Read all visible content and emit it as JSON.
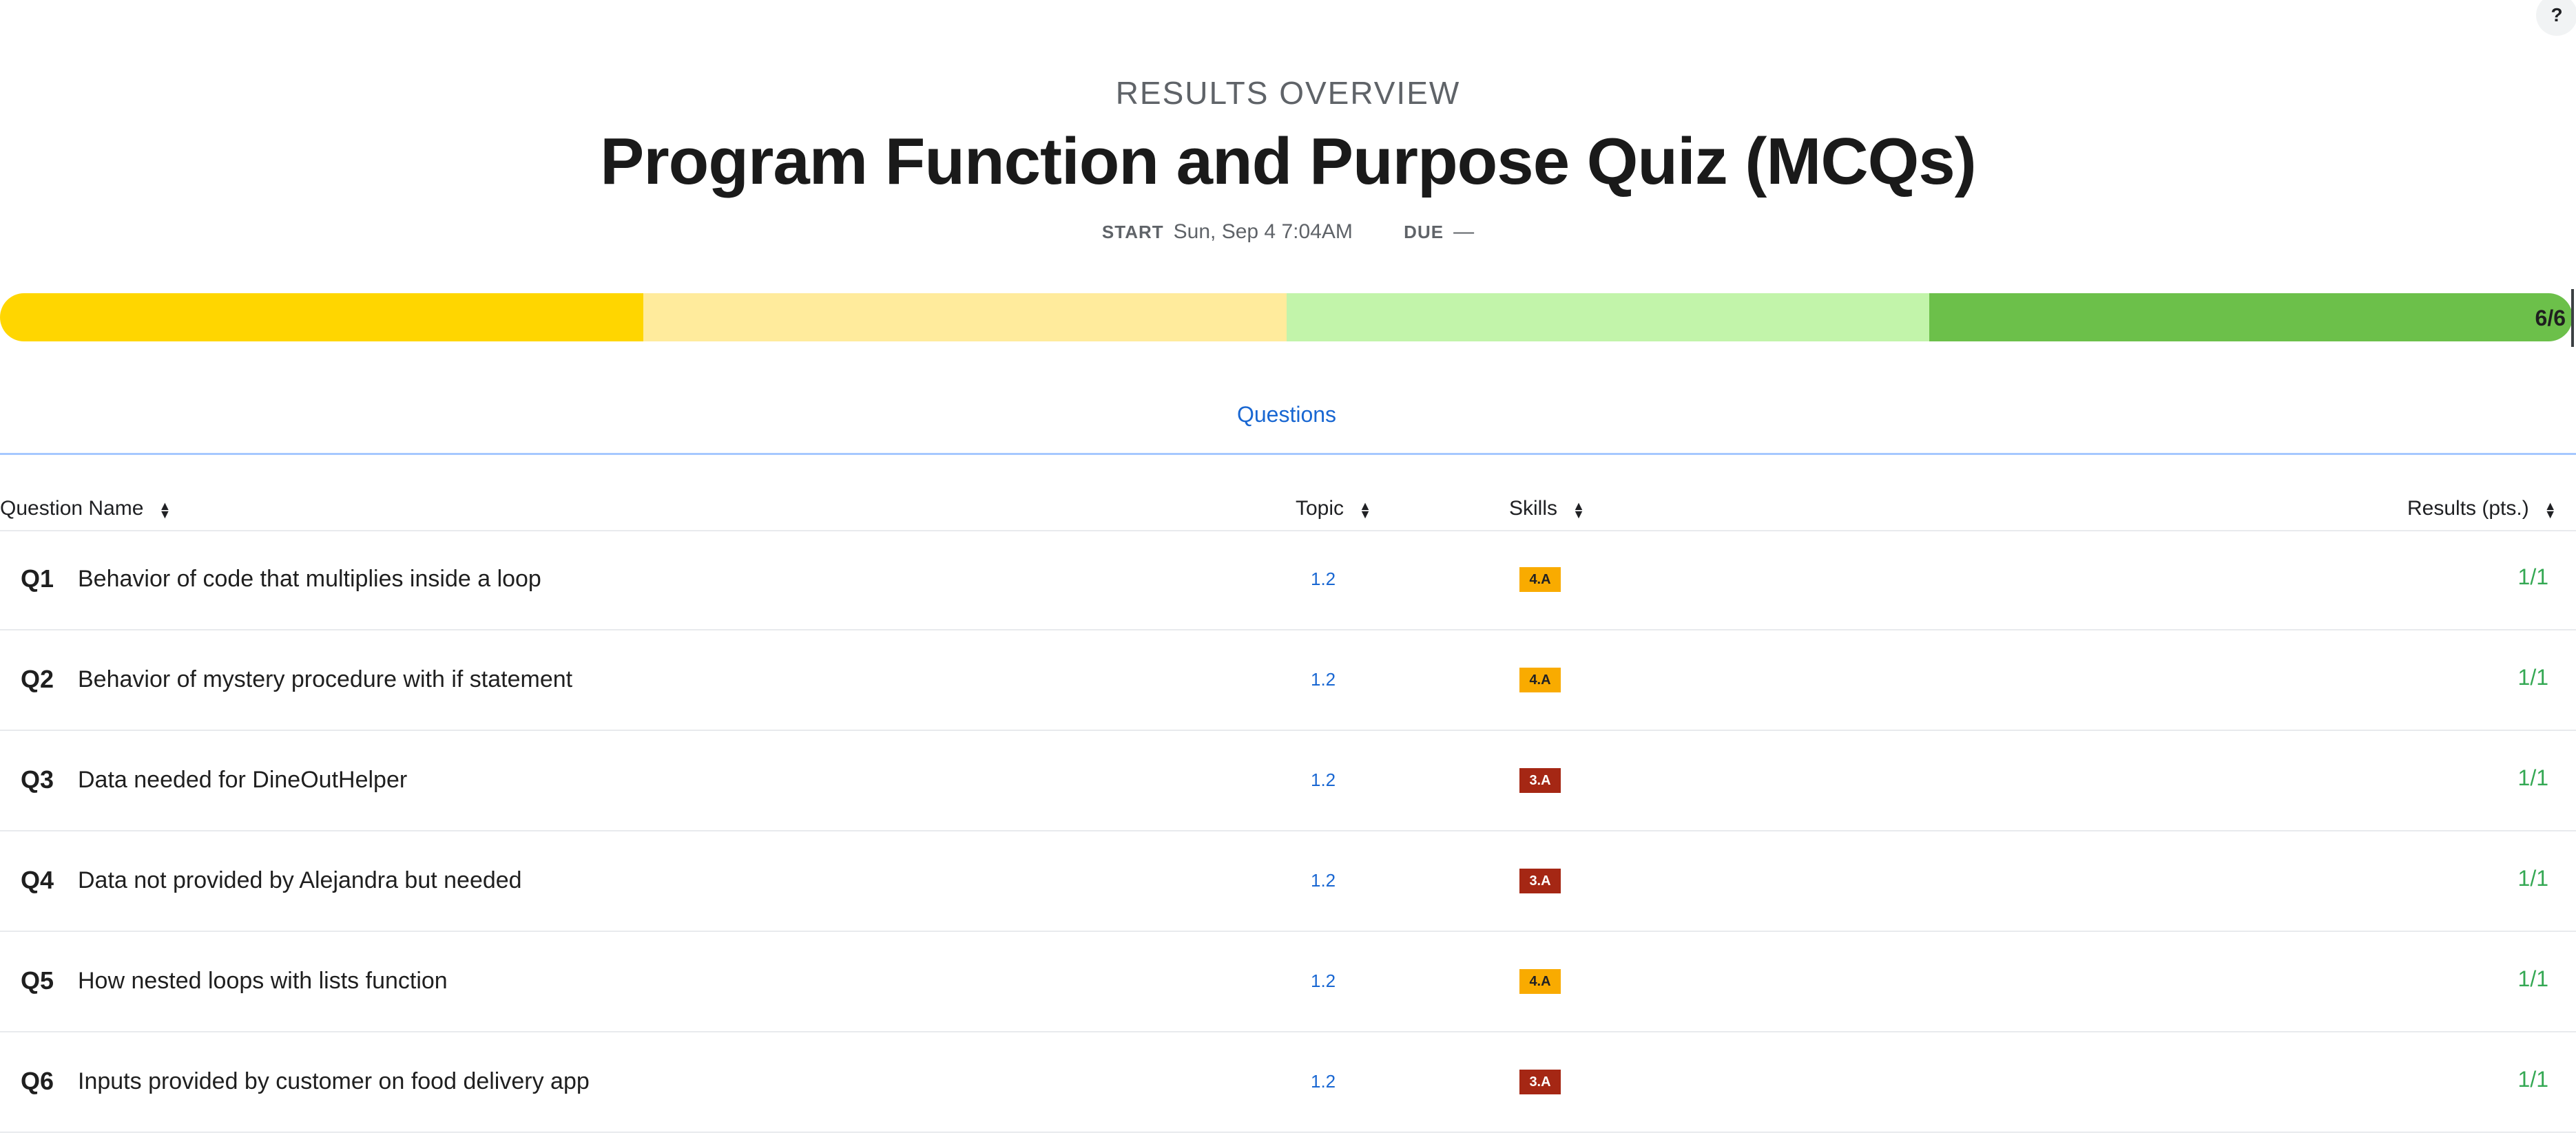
{
  "help": {
    "icon": "help-icon",
    "label": "?"
  },
  "header": {
    "eyebrow": "RESULTS OVERVIEW",
    "title": "Program Function and Purpose Quiz (MCQs)",
    "start_label": "START",
    "start_value": "Sun, Sep 4 7:04AM",
    "due_label": "DUE",
    "due_value": "—"
  },
  "progress": {
    "score_text": "6/6",
    "fraction": 1.0,
    "segment_colors": [
      "#ffd600",
      "#ffeb9c",
      "#c2f4aa",
      "#6cc04a"
    ]
  },
  "tabs": [
    {
      "label": "Questions",
      "active": true
    }
  ],
  "table": {
    "headers": {
      "question_name": "Question Name",
      "topic": "Topic",
      "skills": "Skills",
      "results": "Results (pts.)"
    },
    "rows": [
      {
        "num": "Q1",
        "name": "Behavior of code that multiplies inside a loop",
        "topic": "1.2",
        "skill": "4.A",
        "result": "1/1"
      },
      {
        "num": "Q2",
        "name": "Behavior of mystery procedure with if statement",
        "topic": "1.2",
        "skill": "4.A",
        "result": "1/1"
      },
      {
        "num": "Q3",
        "name": "Data needed for DineOutHelper",
        "topic": "1.2",
        "skill": "3.A",
        "result": "1/1"
      },
      {
        "num": "Q4",
        "name": "Data not provided by Alejandra but needed",
        "topic": "1.2",
        "skill": "3.A",
        "result": "1/1"
      },
      {
        "num": "Q5",
        "name": "How nested loops with lists function",
        "topic": "1.2",
        "skill": "4.A",
        "result": "1/1"
      },
      {
        "num": "Q6",
        "name": "Inputs provided by customer on food delivery app",
        "topic": "1.2",
        "skill": "3.A",
        "result": "1/1"
      }
    ]
  },
  "colors": {
    "skill_4A_bg": "#f9ab00",
    "skill_4A_text": "#202124",
    "skill_3A_bg": "#a52714",
    "skill_3A_text": "#ffffff",
    "link_blue": "#1967d2",
    "result_green": "#34a853"
  }
}
